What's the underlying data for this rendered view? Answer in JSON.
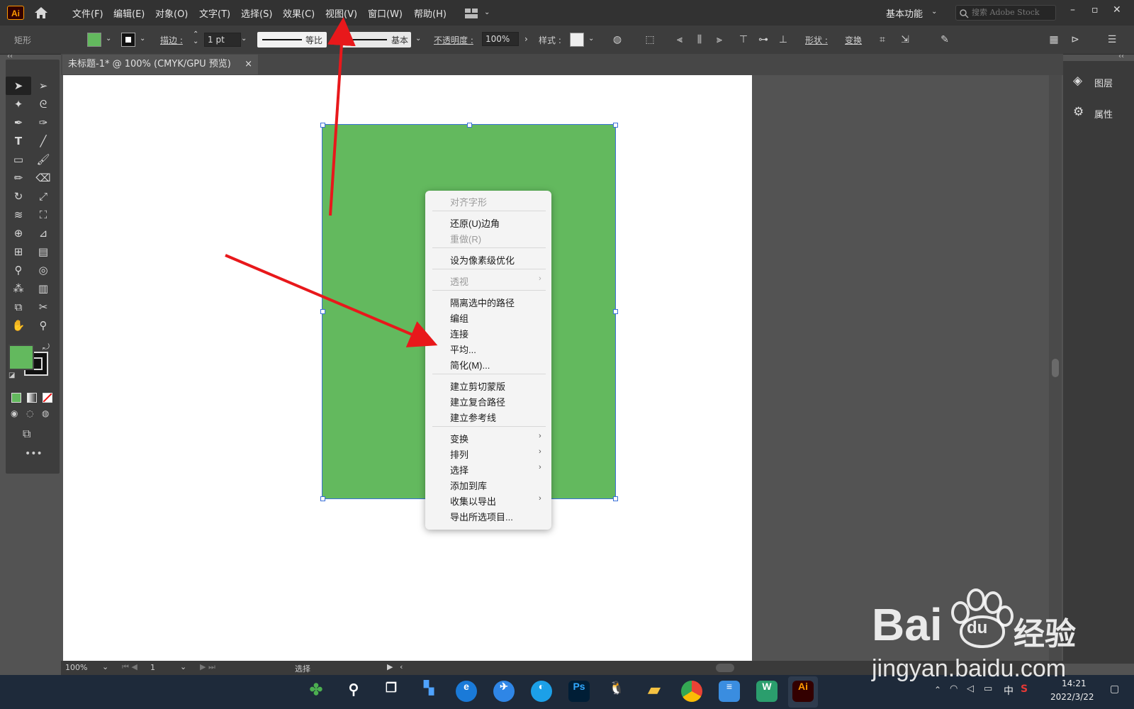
{
  "app": {
    "logo_text": "Ai"
  },
  "menubar": {
    "items": [
      "文件(F)",
      "编辑(E)",
      "对象(O)",
      "文字(T)",
      "选择(S)",
      "效果(C)",
      "视图(V)",
      "窗口(W)",
      "帮助(H)"
    ],
    "workspace_label": "基本功能",
    "search_placeholder": "搜索 Adobe Stock"
  },
  "control_bar": {
    "object_type": "矩形",
    "stroke_label": "描边 :",
    "stroke_weight": "1 pt",
    "stroke_profile_label": "等比",
    "brush_label": "基本",
    "opacity_label": "不透明度 :",
    "opacity_value": "100%",
    "style_label": "样式 :",
    "shape_label": "形状 :",
    "transform_label": "变换"
  },
  "colors": {
    "fill": "#63b95e",
    "stroke": "#000000",
    "accent": "#3a6fd8",
    "annotation_arrow": "#e8181b"
  },
  "document_tab": {
    "title": "未标题-1* @ 100% (CMYK/GPU 预览)",
    "close_glyph": "×"
  },
  "right_panel": {
    "items": [
      {
        "label": "图层",
        "icon": "layers-icon"
      },
      {
        "label": "属性",
        "icon": "properties-icon"
      }
    ]
  },
  "context_menu": {
    "items": [
      {
        "label": "对齐字形",
        "disabled": true
      },
      {
        "label": "还原(U)边角",
        "disabled": false
      },
      {
        "label": "重做(R)",
        "disabled": true
      },
      {
        "label": "设为像素级优化",
        "disabled": false
      },
      {
        "label": "透视",
        "disabled": true,
        "submenu": true
      },
      {
        "label": "隔离选中的路径",
        "disabled": false
      },
      {
        "label": "编组",
        "disabled": false
      },
      {
        "label": "连接",
        "disabled": false
      },
      {
        "label": "平均...",
        "disabled": false
      },
      {
        "label": "简化(M)...",
        "disabled": false
      },
      {
        "label": "建立剪切蒙版",
        "disabled": false
      },
      {
        "label": "建立复合路径",
        "disabled": false
      },
      {
        "label": "建立参考线",
        "disabled": false
      },
      {
        "label": "变换",
        "disabled": false,
        "submenu": true
      },
      {
        "label": "排列",
        "disabled": false,
        "submenu": true
      },
      {
        "label": "选择",
        "disabled": false,
        "submenu": true
      },
      {
        "label": "添加到库",
        "disabled": false
      },
      {
        "label": "收集以导出",
        "disabled": false,
        "submenu": true
      },
      {
        "label": "导出所选项目...",
        "disabled": false
      }
    ],
    "submenu_glyph": "›"
  },
  "status_bar": {
    "zoom": "100%",
    "artboard_number": "1",
    "current_tool": "选择"
  },
  "taskbar": {
    "apps": [
      "start",
      "search",
      "task-view",
      "widgets",
      "edge",
      "feishu",
      "browser",
      "Ps",
      "qq",
      "explorer",
      "chrome",
      "notepad",
      "wps",
      "Ai"
    ],
    "tray": {
      "ime": "中",
      "time": "14:21",
      "date": "2022/3/22"
    }
  },
  "watermark": {
    "brand": "Bai",
    "brand_tail": "经验",
    "paw_text": "du",
    "url": "jingyan.baidu.com"
  }
}
